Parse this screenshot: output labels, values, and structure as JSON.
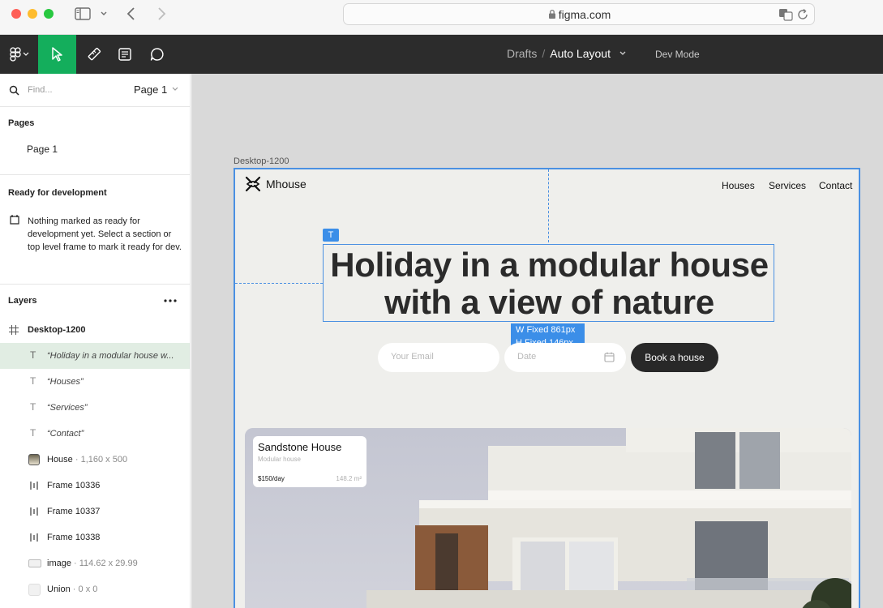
{
  "browser": {
    "url": "figma.com"
  },
  "toolbar": {
    "breadcrumb_root": "Drafts",
    "breadcrumb_separator": "/",
    "file_name": "Auto Layout",
    "dev_mode_label": "Dev Mode"
  },
  "left_panel": {
    "find_placeholder": "Find...",
    "page_selector": "Page 1",
    "pages_title": "Pages",
    "pages": [
      "Page 1"
    ],
    "ready_title": "Ready for development",
    "ready_message": "Nothing marked as ready for development yet. Select a section or top level frame to mark it ready for dev.",
    "layers_title": "Layers",
    "layers": [
      {
        "name": "Desktop-1200",
        "detail": ""
      },
      {
        "name": "“Holiday in a modular house w...",
        "detail": ""
      },
      {
        "name": "“Houses”",
        "detail": ""
      },
      {
        "name": "“Services”",
        "detail": ""
      },
      {
        "name": "“Contact”",
        "detail": ""
      },
      {
        "name": "House",
        "detail": " · 1,160 x 500"
      },
      {
        "name": "Frame 10336",
        "detail": ""
      },
      {
        "name": "Frame 10337",
        "detail": ""
      },
      {
        "name": "Frame 10338",
        "detail": ""
      },
      {
        "name": "image",
        "detail": " · 114.62 x 29.99"
      },
      {
        "name": "Union",
        "detail": " · 0 x 0"
      }
    ]
  },
  "canvas": {
    "frame_label": "Desktop-1200",
    "site": {
      "logo": "Mhouse",
      "nav": [
        "Houses",
        "Services",
        "Contact"
      ],
      "headline_line1": "Holiday in a modular house",
      "headline_line2": "with a view of nature",
      "selection_width": "W Fixed 861px",
      "selection_height": "H Fixed 146px",
      "email_placeholder": "Your Email",
      "date_placeholder": "Date",
      "cta": "Book a house",
      "card": {
        "title": "Sandstone House",
        "subtitle": "Modular house",
        "price": "$150/day",
        "area": "148.2 m²"
      }
    }
  },
  "colors": {
    "selection": "#4a90e2",
    "active_tool": "#14ae5c",
    "toolbar_bg": "#2c2c2c"
  }
}
